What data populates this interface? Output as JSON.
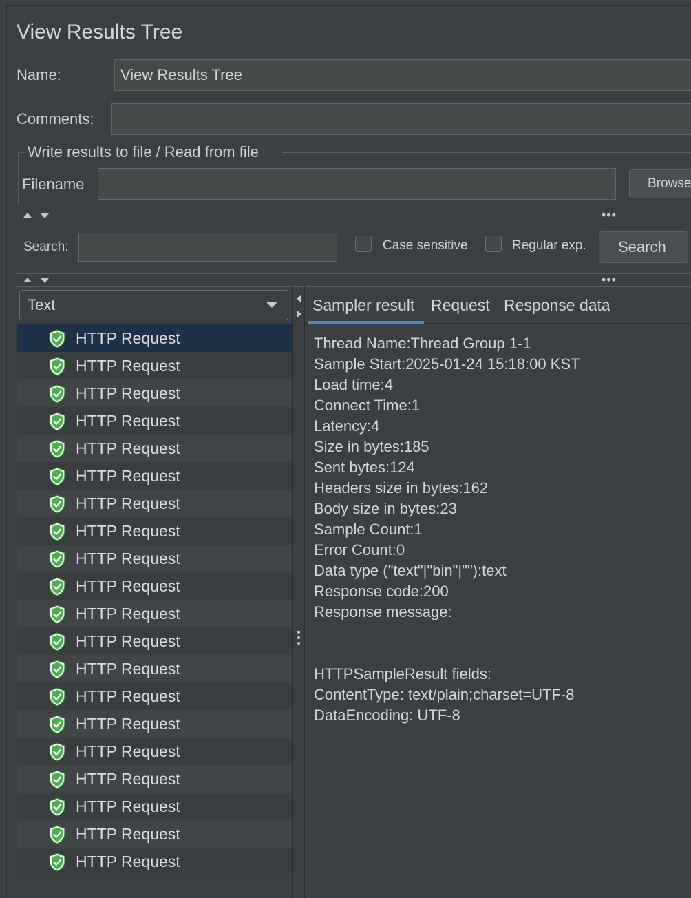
{
  "title": "View Results Tree",
  "name_label": "Name:",
  "name_value": "View Results Tree",
  "comments_label": "Comments:",
  "comments_value": "",
  "file_group": {
    "title": "Write results to file / Read from file",
    "filename_label": "Filename",
    "filename_value": "",
    "browse_label": "Browse"
  },
  "search": {
    "label": "Search:",
    "value": "",
    "case_sensitive_label": "Case sensitive",
    "case_sensitive_checked": false,
    "regex_label": "Regular exp.",
    "regex_checked": false,
    "button_label": "Search"
  },
  "renderer": {
    "selected": "Text"
  },
  "tree": {
    "items": [
      {
        "label": "HTTP Request",
        "status": "success",
        "selected": true
      },
      {
        "label": "HTTP Request",
        "status": "success",
        "selected": false
      },
      {
        "label": "HTTP Request",
        "status": "success",
        "selected": false
      },
      {
        "label": "HTTP Request",
        "status": "success",
        "selected": false
      },
      {
        "label": "HTTP Request",
        "status": "success",
        "selected": false
      },
      {
        "label": "HTTP Request",
        "status": "success",
        "selected": false
      },
      {
        "label": "HTTP Request",
        "status": "success",
        "selected": false
      },
      {
        "label": "HTTP Request",
        "status": "success",
        "selected": false
      },
      {
        "label": "HTTP Request",
        "status": "success",
        "selected": false
      },
      {
        "label": "HTTP Request",
        "status": "success",
        "selected": false
      },
      {
        "label": "HTTP Request",
        "status": "success",
        "selected": false
      },
      {
        "label": "HTTP Request",
        "status": "success",
        "selected": false
      },
      {
        "label": "HTTP Request",
        "status": "success",
        "selected": false
      },
      {
        "label": "HTTP Request",
        "status": "success",
        "selected": false
      },
      {
        "label": "HTTP Request",
        "status": "success",
        "selected": false
      },
      {
        "label": "HTTP Request",
        "status": "success",
        "selected": false
      },
      {
        "label": "HTTP Request",
        "status": "success",
        "selected": false
      },
      {
        "label": "HTTP Request",
        "status": "success",
        "selected": false
      },
      {
        "label": "HTTP Request",
        "status": "success",
        "selected": false
      },
      {
        "label": "HTTP Request",
        "status": "success",
        "selected": false
      }
    ]
  },
  "tabs": [
    {
      "label": "Sampler result",
      "active": true
    },
    {
      "label": "Request",
      "active": false
    },
    {
      "label": "Response data",
      "active": false
    }
  ],
  "sampler_result": {
    "lines": [
      "Thread Name:Thread Group 1-1",
      "Sample Start:2025-01-24 15:18:00 KST",
      "Load time:4",
      "Connect Time:1",
      "Latency:4",
      "Size in bytes:185",
      "Sent bytes:124",
      "Headers size in bytes:162",
      "Body size in bytes:23",
      "Sample Count:1",
      "Error Count:0",
      "Data type (\"text\"|\"bin\"|\"\"):text",
      "Response code:200",
      "Response message:",
      "",
      "",
      "HTTPSampleResult fields:",
      "ContentType: text/plain;charset=UTF-8",
      "DataEncoding: UTF-8"
    ]
  },
  "colors": {
    "background": "#3c3f41",
    "selected_row": "#1e3146",
    "tab_accent": "#4a88c7",
    "success_icon": "#4caf50"
  },
  "icons": {
    "tree_item": "shield-check-icon",
    "combo_arrow": "chevron-down-icon",
    "splitter_collapse": "arrow-up-icon",
    "splitter_expand": "arrow-down-icon",
    "splitter_more": "ellipsis-icon"
  }
}
